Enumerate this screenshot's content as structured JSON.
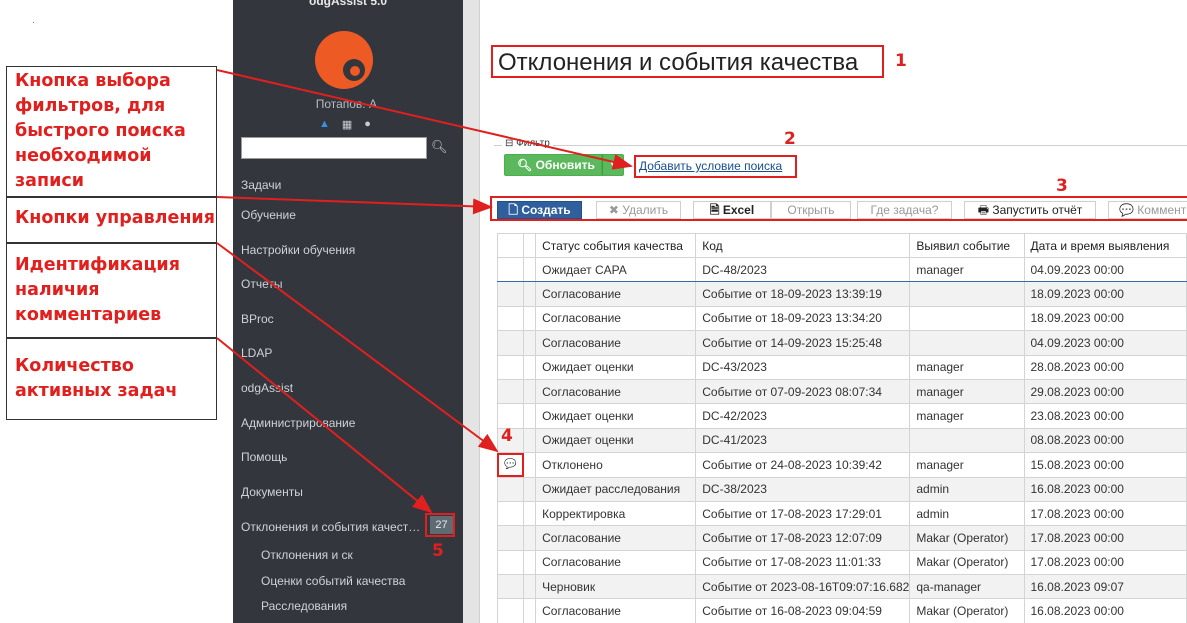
{
  "sidebar": {
    "app_title": "odgAssist 5.0",
    "user_name": "Потапов. А.",
    "search_placeholder": "",
    "menu": [
      "Задачи",
      "Обучение",
      "Настройки обучения",
      "Отчеты",
      "BProc",
      "LDAP",
      "odgAssist",
      "Администрирование",
      "Помощь",
      "Документы",
      "Отклонения и события качест…"
    ],
    "submenu": [
      "Отклонения и ск",
      "Оценки событий качества",
      "Расследования"
    ],
    "active_tasks_count": "27"
  },
  "annotations": {
    "filters_button": "Кнопка выбора фильтров, для быстрого поиска необходимой записи",
    "control_buttons": "Кнопки управления",
    "comments_indicator": "Идентификация наличия комментариев",
    "active_tasks": "Количество активных задач",
    "numbers": [
      "1",
      "2",
      "3",
      "4",
      "5"
    ]
  },
  "page": {
    "title": "Отклонения и события качества",
    "filter_label": "⊟ Фильтр",
    "refresh_label": "Обновить",
    "add_condition_label": "Добавить условие поиска"
  },
  "toolbar": {
    "create": "Создать",
    "delete": "Удалить",
    "excel": "Excel",
    "open": "Открыть",
    "where_task": "Где задача?",
    "run_report": "Запустить отчёт",
    "comment": "Коммент"
  },
  "table": {
    "headers": [
      "Статус события качества",
      "Код",
      "Выявил событие",
      "Дата и время выявления"
    ],
    "rows": [
      {
        "comment": "",
        "status": "Ожидает CAPA",
        "code": "DC-48/2023",
        "who": "manager",
        "date": "04.09.2023 00:00"
      },
      {
        "comment": "",
        "status": "Согласование",
        "code": "Событие от 18-09-2023 13:39:19",
        "who": "",
        "date": "18.09.2023 00:00"
      },
      {
        "comment": "",
        "status": "Согласование",
        "code": "Событие от 18-09-2023 13:34:20",
        "who": "",
        "date": "18.09.2023 00:00"
      },
      {
        "comment": "",
        "status": "Согласование",
        "code": "Событие от 14-09-2023 15:25:48",
        "who": "",
        "date": "04.09.2023 00:00"
      },
      {
        "comment": "",
        "status": "Ожидает оценки",
        "code": "DC-43/2023",
        "who": "manager",
        "date": "28.08.2023 00:00"
      },
      {
        "comment": "",
        "status": "Согласование",
        "code": "Событие от 07-09-2023 08:07:34",
        "who": "manager",
        "date": "29.08.2023 00:00"
      },
      {
        "comment": "",
        "status": "Ожидает оценки",
        "code": "DC-42/2023",
        "who": "manager",
        "date": "23.08.2023 00:00"
      },
      {
        "comment": "",
        "status": "Ожидает оценки",
        "code": "DC-41/2023",
        "who": "",
        "date": "08.08.2023 00:00"
      },
      {
        "comment": "💬",
        "status": "Отклонено",
        "code": "Событие от 24-08-2023 10:39:42",
        "who": "manager",
        "date": "15.08.2023 00:00"
      },
      {
        "comment": "",
        "status": "Ожидает расследования",
        "code": "DC-38/2023",
        "who": "admin",
        "date": "16.08.2023 00:00"
      },
      {
        "comment": "",
        "status": "Корректировка",
        "code": "Событие от 17-08-2023 17:29:01",
        "who": "admin",
        "date": "17.08.2023 00:00"
      },
      {
        "comment": "",
        "status": "Согласование",
        "code": "Событие от 17-08-2023 12:07:09",
        "who": "Makar (Operator)",
        "date": "17.08.2023 00:00"
      },
      {
        "comment": "",
        "status": "Согласование",
        "code": "Событие от 17-08-2023 11:01:33",
        "who": "Makar (Operator)",
        "date": "17.08.2023 00:00"
      },
      {
        "comment": "",
        "status": "Черновик",
        "code": "Событие от 2023-08-16T09:07:16.682",
        "who": "qa-manager",
        "date": "16.08.2023 09:07"
      },
      {
        "comment": "",
        "status": "Согласование",
        "code": "Событие от 16-08-2023 09:04:59",
        "who": "Makar (Operator)",
        "date": "16.08.2023 00:00"
      }
    ]
  },
  "colors": {
    "accent": "#e0201e",
    "sidebar": "#33363d",
    "primary": "#2f5f9c",
    "success": "#5cb85c"
  }
}
